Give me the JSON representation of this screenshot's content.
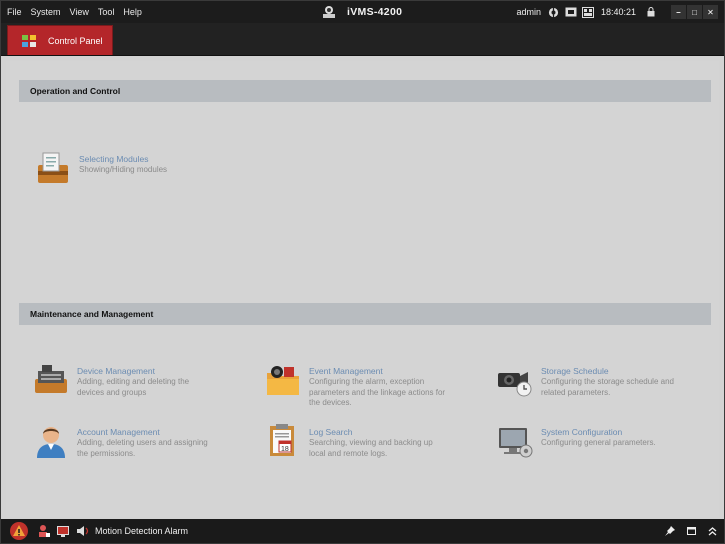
{
  "menu": [
    "File",
    "System",
    "View",
    "Tool",
    "Help"
  ],
  "app_title": "iVMS-4200",
  "status": {
    "user": "admin",
    "time": "18:40:21"
  },
  "tab": {
    "label": "Control Panel"
  },
  "sections": [
    {
      "title": "Operation and Control",
      "modules": [
        {
          "title": "Selecting Modules",
          "desc": [
            "Showing/Hiding modules"
          ]
        }
      ]
    },
    {
      "title": "Maintenance and Management",
      "modules": [
        {
          "title": "Device Management",
          "desc": [
            "Adding, editing and deleting the",
            "devices and groups"
          ]
        },
        {
          "title": "Event Management",
          "desc": [
            "Configuring the alarm, exception",
            "parameters and the linkage actions for",
            "the devices."
          ]
        },
        {
          "title": "Storage Schedule",
          "desc": [
            "Configuring the storage schedule and",
            "related parameters."
          ]
        },
        {
          "title": "Account Management",
          "desc": [
            "Adding, deleting users and assigning",
            "the permissions."
          ]
        },
        {
          "title": "Log Search",
          "desc": [
            "Searching, viewing and backing up",
            "local and remote logs."
          ]
        },
        {
          "title": "System Configuration",
          "desc": [
            "Configuring general parameters."
          ]
        }
      ]
    }
  ],
  "statusbar": {
    "alarm_label": "Motion Detection Alarm"
  },
  "colors": {
    "tab_active": "#b4262a",
    "module_title": "#6b8cb2",
    "section_header": "#b8bcc0"
  }
}
